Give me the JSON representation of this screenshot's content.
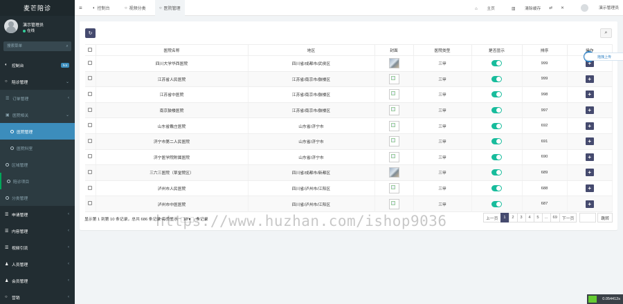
{
  "brand": "麦芒陪诊",
  "user": {
    "name": "演示管理员",
    "status": "在线"
  },
  "side_search_placeholder": "搜索菜单",
  "menu": [
    {
      "label": "控制台",
      "icon": "dashboard-icon",
      "badge": "hot",
      "kind": "top"
    },
    {
      "label": "陪诊管理",
      "icon": "circle-icon",
      "chev": "⌄",
      "kind": "top"
    },
    {
      "label": "订单管理",
      "icon": "list-icon",
      "chev": "‹",
      "kind": "sub"
    },
    {
      "label": "医院相关",
      "icon": "hospital-icon",
      "chev": "⌄",
      "kind": "sub"
    },
    {
      "label": "医院管理",
      "icon": "circle-icon",
      "kind": "sub2 active"
    },
    {
      "label": "医院科室",
      "icon": "circle-icon",
      "kind": "sub2"
    },
    {
      "label": "区域管理",
      "icon": "circle-icon",
      "kind": "sub"
    },
    {
      "label": "陪诊项目",
      "icon": "circle-icon",
      "kind": "sub green"
    },
    {
      "label": "分类管理",
      "icon": "circle-icon",
      "kind": "sub"
    },
    {
      "label": "申请管理",
      "icon": "list-icon",
      "chev": "‹",
      "kind": "top"
    },
    {
      "label": "内容管理",
      "icon": "list-icon",
      "chev": "‹",
      "kind": "top"
    },
    {
      "label": "视频引流",
      "icon": "list-icon",
      "chev": "‹",
      "kind": "top"
    },
    {
      "label": "人员管理",
      "icon": "user-icon",
      "chev": "‹",
      "kind": "top"
    },
    {
      "label": "会员管理",
      "icon": "user-icon",
      "chev": "‹",
      "kind": "top"
    },
    {
      "label": "营销",
      "icon": "circle-icon",
      "chev": "‹",
      "kind": "top"
    }
  ],
  "tabs": [
    {
      "label": "控制台",
      "icon": "dashboard-icon"
    },
    {
      "label": "视频分类",
      "icon": "circle-icon"
    },
    {
      "label": "医院管理",
      "icon": "circle-icon"
    }
  ],
  "topbar_right": {
    "home": "主页",
    "clear_cache": "清除缓存",
    "admin": "演示管理员"
  },
  "table": {
    "headers": [
      "医院名称",
      "地区",
      "封面",
      "医院类型",
      "是否显示",
      "排序",
      "操作"
    ],
    "rows": [
      {
        "name": "四川大学华西医院",
        "region": "四川省/成都市/武侯区",
        "cover": "img",
        "type": "三甲",
        "sort": "999"
      },
      {
        "name": "江苏省人民医院",
        "region": "江苏省/南京市/鼓楼区",
        "cover": "broken",
        "type": "三甲",
        "sort": "999"
      },
      {
        "name": "江苏省中医院",
        "region": "江苏省/南京市/鼓楼区",
        "cover": "broken",
        "type": "三甲",
        "sort": "998"
      },
      {
        "name": "南京鼓楼医院",
        "region": "江苏省/南京市/鼓楼区",
        "cover": "broken",
        "type": "三甲",
        "sort": "997"
      },
      {
        "name": "山东省戴庄医院",
        "region": "山东省/济宁市",
        "cover": "broken",
        "type": "三甲",
        "sort": "692"
      },
      {
        "name": "济宁市第二人民医院",
        "region": "山东省/济宁市",
        "cover": "broken",
        "type": "三甲",
        "sort": "691"
      },
      {
        "name": "济宁医学院附属医院",
        "region": "山东省/济宁市",
        "cover": "broken",
        "type": "三甲",
        "sort": "690"
      },
      {
        "name": "三六三医院（草堂院区）",
        "region": "四川省/成都市/新都区",
        "cover": "img",
        "type": "三甲",
        "sort": "689"
      },
      {
        "name": "泸州市人民医院",
        "region": "四川省/泸州市/江阳区",
        "cover": "broken",
        "type": "三甲",
        "sort": "688"
      },
      {
        "name": "泸州市中医医院",
        "region": "四川省/泸州市/江阳区",
        "cover": "broken",
        "type": "三甲",
        "sort": "687"
      }
    ]
  },
  "pager": {
    "summary_pre": "显示第 1 到第 10 条记录，总共 686 条记录 每页显示",
    "page_size": "10 ▾",
    "summary_post": "条记录",
    "prev": "上一页",
    "pages": [
      "1",
      "2",
      "3",
      "4",
      "5",
      "...",
      "69"
    ],
    "next": "下一页",
    "jump": "跳转"
  },
  "float_upload": "拖拽上传",
  "timer": "0.054412s",
  "watermark": "https://www.huzhan.com/ishop9036"
}
